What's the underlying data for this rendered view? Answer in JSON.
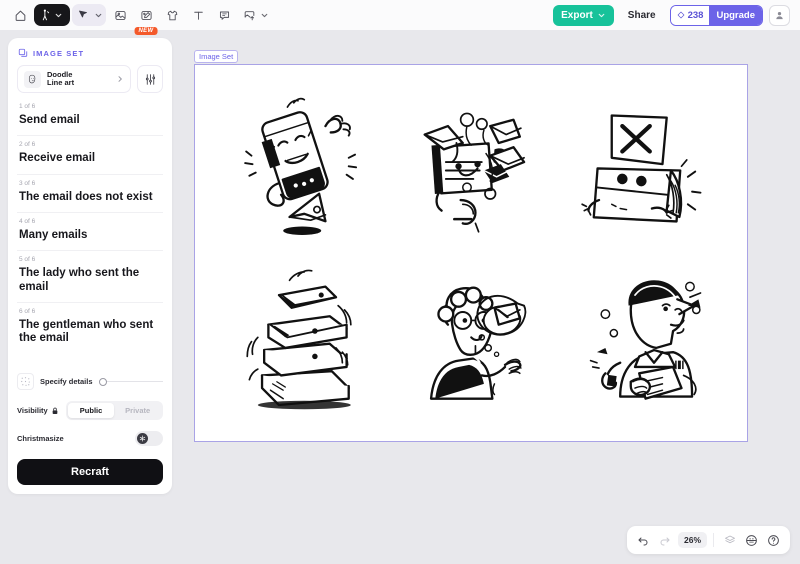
{
  "topbar": {
    "tools": [
      {
        "name": "home-icon",
        "label": "Home"
      },
      {
        "name": "image-generate-tool",
        "label": "Generate image"
      },
      {
        "name": "vector-select-tool",
        "label": "Vector select"
      },
      {
        "name": "image-tool",
        "label": "Image"
      },
      {
        "name": "image-edit-tool",
        "label": "Image edit",
        "badge": "NEW"
      },
      {
        "name": "mockup-tool",
        "label": "Mockup"
      },
      {
        "name": "text-tool",
        "label": "T"
      },
      {
        "name": "speech-bubble-tool",
        "label": "Comment"
      },
      {
        "name": "upload-tool",
        "label": "Upload"
      }
    ],
    "export_label": "Export",
    "share_label": "Share",
    "credits_value": "238",
    "upgrade_label": "Upgrade"
  },
  "panel": {
    "section_title": "IMAGE SET",
    "style": {
      "line1": "Doodle",
      "line2": "Line art"
    },
    "prompts": [
      {
        "count": "1 of 6",
        "text": "Send email"
      },
      {
        "count": "2 of 6",
        "text": "Receive email"
      },
      {
        "count": "3 of 6",
        "text": "The email does not exist"
      },
      {
        "count": "4 of 6",
        "text": "Many emails"
      },
      {
        "count": "5 of 6",
        "text": "The lady who sent the email"
      },
      {
        "count": "6 of 6",
        "text": "The gentleman who sent the email"
      }
    ],
    "details_label": "Specify details",
    "visibility_label": "Visibility",
    "visibility_options": [
      {
        "label": "Public",
        "selected": true
      },
      {
        "label": "Private",
        "selected": false
      }
    ],
    "christmasize_label": "Christmasize",
    "recraft_label": "Recraft"
  },
  "canvas": {
    "tag_label": "Image Set",
    "images": [
      {
        "name": "send-email-illustration",
        "alt": "Send email"
      },
      {
        "name": "receive-email-illustration",
        "alt": "Receive email"
      },
      {
        "name": "email-does-not-exist-illustration",
        "alt": "The email does not exist"
      },
      {
        "name": "many-emails-illustration",
        "alt": "Many emails"
      },
      {
        "name": "lady-who-sent-email-illustration",
        "alt": "The lady who sent the email"
      },
      {
        "name": "gentleman-who-sent-email-illustration",
        "alt": "The gentleman who sent the email"
      }
    ]
  },
  "zoombar": {
    "zoom_level": "26%"
  },
  "colors": {
    "accent_purple": "#6c63e8",
    "export_green": "#17c29a",
    "badge_orange": "#f4592a",
    "canvas_border": "#a9a3e6",
    "app_bg": "#e8e8ec"
  }
}
